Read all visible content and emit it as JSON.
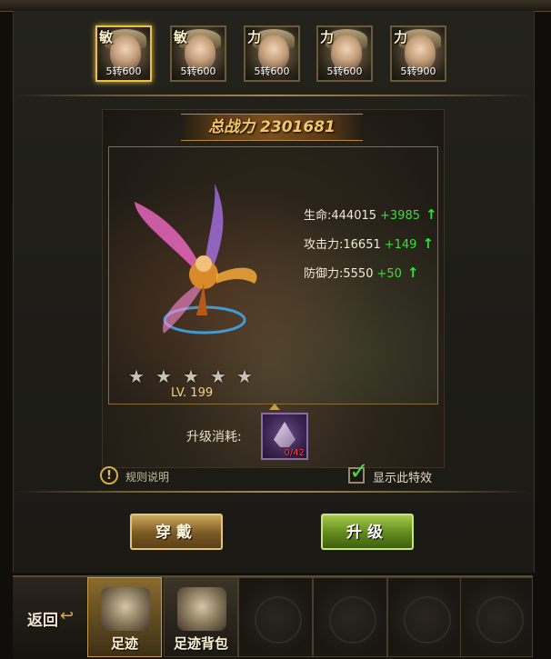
{
  "heroes": [
    {
      "type": "敏",
      "rank": "5转600",
      "selected": true
    },
    {
      "type": "敏",
      "rank": "5转600",
      "selected": false
    },
    {
      "type": "力",
      "rank": "5转600",
      "selected": false
    },
    {
      "type": "力",
      "rank": "5转600",
      "selected": false
    },
    {
      "type": "力",
      "rank": "5转900",
      "selected": false
    }
  ],
  "power": {
    "label": "总战力",
    "value": "2301681"
  },
  "stats": [
    {
      "label": "生命:444015",
      "bonus": "+3985"
    },
    {
      "label": "攻击力:16651",
      "bonus": "+149"
    },
    {
      "label": "防御力:5550",
      "bonus": "+50"
    }
  ],
  "stars": 5,
  "level": "LV. 199",
  "cost": {
    "label": "升级消耗:",
    "qty": "0/42"
  },
  "rules_text": "规则说明",
  "effect_text": "显示此特效",
  "buttons": {
    "equip": "穿戴",
    "upgrade": "升级"
  },
  "nav": {
    "back": "返回",
    "tabs": [
      {
        "label": "足迹",
        "active": true
      },
      {
        "label": "足迹背包",
        "active": false
      }
    ]
  },
  "colors": {
    "accent_gold": "#e8c04a",
    "bonus_green": "#34e03a",
    "qty_red": "#ff3b3b"
  }
}
